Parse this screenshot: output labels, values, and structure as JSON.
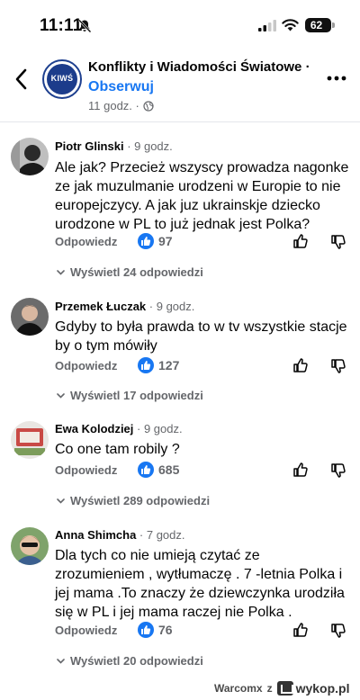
{
  "status_bar": {
    "time": "11:11",
    "battery": "62"
  },
  "post": {
    "page_name": "Konflikty i Wiadomości Światowe ·",
    "follow_label": "Obserwuj",
    "meta": "11 godz. ·",
    "logo_text": "KIWŚ"
  },
  "comments": [
    {
      "author": "Piotr Glinski",
      "time": " · 9 godz.",
      "text": "Ale jak? Przecież wszyscy prowadza nagonke ze jak muzulmanie urodzeni w Europie to nie europejczycy. A jak juz ukrainskje dziecko urodzone w PL to już jednak jest Polka?",
      "reply": "Odpowiedz",
      "likes": "97",
      "view_replies": "Wyświetl 24 odpowiedzi"
    },
    {
      "author": "Przemek Łuczak",
      "time": " · 9 godz.",
      "text": "Gdyby to była prawda to w tv wszystkie stacje by o tym mówiły",
      "reply": "Odpowiedz",
      "likes": "127",
      "view_replies": "Wyświetl 17 odpowiedzi"
    },
    {
      "author": "Ewa Kolodziej",
      "time": " · 9 godz.",
      "text": "Co one tam robily ?",
      "reply": "Odpowiedz",
      "likes": "685",
      "view_replies": "Wyświetl 289 odpowiedzi"
    },
    {
      "author": "Anna Shimcha",
      "time": " · 7 godz.",
      "text": "Dla tych co nie umieją czytać ze zrozumieniem , wytłumaczę . 7 -letnia Polka i jej mama .To znaczy że dziewczynka urodziła się w PL i jej mama raczej nie Polka .",
      "reply": "Odpowiedz",
      "likes": "76",
      "view_replies": "Wyświetl 20 odpowiedzi"
    }
  ],
  "watermark": {
    "user": "Warcomx",
    "z": "z",
    "site": "wykop.pl"
  },
  "colors": {
    "accent": "#1877f2",
    "muted": "#65676b",
    "text": "#050505"
  }
}
